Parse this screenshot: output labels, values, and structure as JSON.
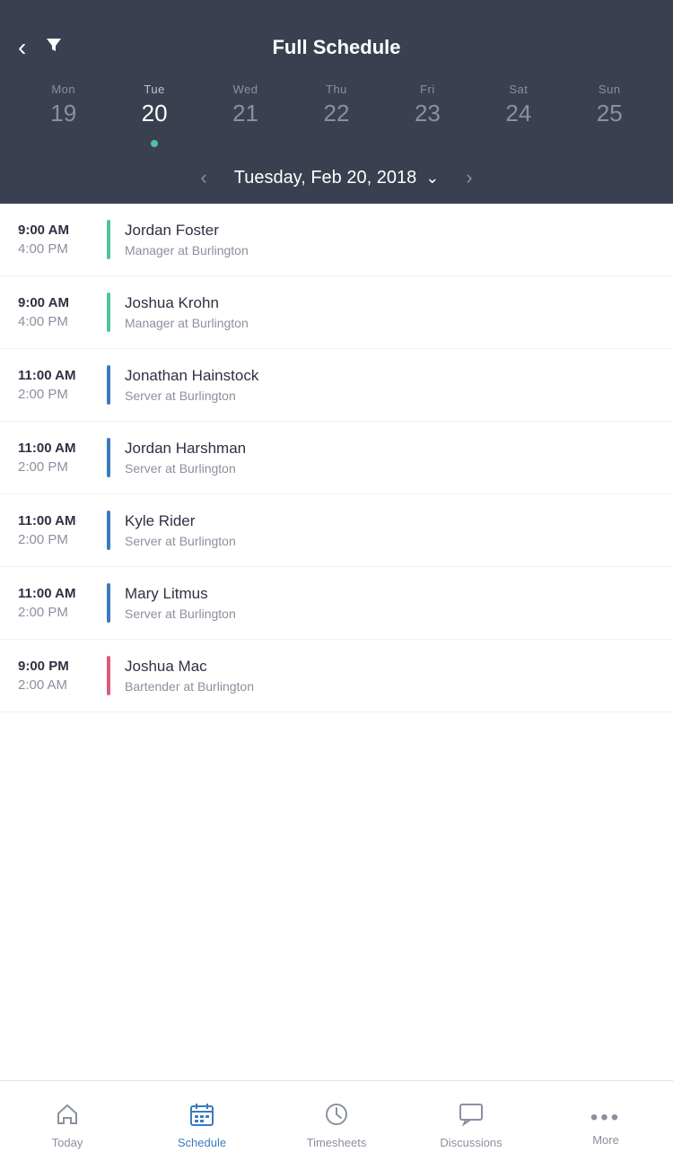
{
  "header": {
    "title": "Full Schedule",
    "back_label": "‹",
    "filter_label": "▼"
  },
  "calendar": {
    "days": [
      {
        "name": "Mon",
        "num": "19",
        "active": false,
        "dot": false
      },
      {
        "name": "Tue",
        "num": "20",
        "active": true,
        "dot": true
      },
      {
        "name": "Wed",
        "num": "21",
        "active": false,
        "dot": false
      },
      {
        "name": "Thu",
        "num": "22",
        "active": false,
        "dot": false
      },
      {
        "name": "Fri",
        "num": "23",
        "active": false,
        "dot": false
      },
      {
        "name": "Sat",
        "num": "24",
        "active": false,
        "dot": false
      },
      {
        "name": "Sun",
        "num": "25",
        "active": false,
        "dot": false
      }
    ],
    "selected_date": "Tuesday, Feb 20, 2018"
  },
  "schedule": {
    "items": [
      {
        "start": "9:00 AM",
        "end": "4:00 PM",
        "name": "Jordan Foster",
        "role": "Manager at Burlington",
        "color": "teal"
      },
      {
        "start": "9:00 AM",
        "end": "4:00 PM",
        "name": "Joshua Krohn",
        "role": "Manager at Burlington",
        "color": "teal"
      },
      {
        "start": "11:00 AM",
        "end": "2:00 PM",
        "name": "Jonathan Hainstock",
        "role": "Server at Burlington",
        "color": "blue"
      },
      {
        "start": "11:00 AM",
        "end": "2:00 PM",
        "name": "Jordan Harshman",
        "role": "Server at Burlington",
        "color": "blue"
      },
      {
        "start": "11:00 AM",
        "end": "2:00 PM",
        "name": "Kyle Rider",
        "role": "Server at Burlington",
        "color": "blue"
      },
      {
        "start": "11:00 AM",
        "end": "2:00 PM",
        "name": "Mary Litmus",
        "role": "Server at Burlington",
        "color": "blue"
      },
      {
        "start": "9:00 PM",
        "end": "2:00 AM",
        "name": "Joshua Mac",
        "role": "Bartender at Burlington",
        "color": "pink"
      }
    ]
  },
  "bottom_nav": {
    "items": [
      {
        "label": "Today",
        "icon": "home",
        "active": false
      },
      {
        "label": "Schedule",
        "icon": "calendar",
        "active": true
      },
      {
        "label": "Timesheets",
        "icon": "clock",
        "active": false
      },
      {
        "label": "Discussions",
        "icon": "chat",
        "active": false
      },
      {
        "label": "More",
        "icon": "more",
        "active": false
      }
    ]
  }
}
